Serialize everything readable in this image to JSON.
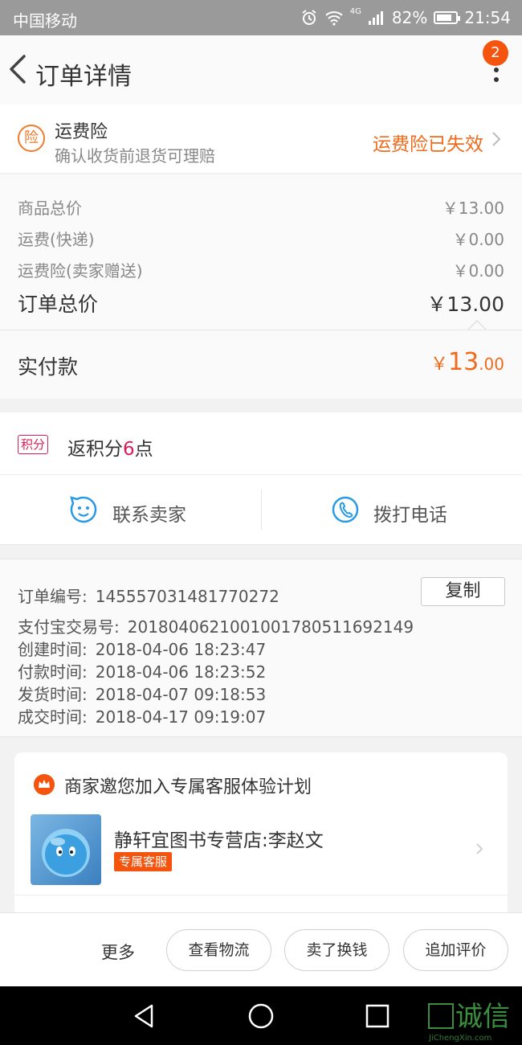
{
  "status_bar": {
    "carrier": "中国移动",
    "network": "4G",
    "battery": "82%",
    "battery_level": 0.82,
    "time": "21:54"
  },
  "nav": {
    "title": "订单详情",
    "badge": "2"
  },
  "insurance": {
    "icon_char": "险",
    "title": "运费险",
    "subtitle": "确认收货前退货可理赔",
    "status": "运费险已失效"
  },
  "prices": {
    "rows": [
      {
        "label": "商品总价",
        "value": "￥13.00"
      },
      {
        "label": "运费(快递)",
        "value": "￥0.00"
      },
      {
        "label": "运费险(卖家赠送)",
        "value": "￥0.00"
      }
    ],
    "total_label": "订单总价",
    "total_value": "￥13.00",
    "paid_label": "实付款",
    "paid_currency": "￥",
    "paid_int": "13",
    "paid_dec": ".00"
  },
  "points": {
    "tag": "积分",
    "prefix": "返积分",
    "num": "6",
    "suffix": "点"
  },
  "contact": {
    "seller": "联系卖家",
    "phone": "拨打电话"
  },
  "order_info": {
    "copy_label": "复制",
    "rows": [
      {
        "k": "订单编号:",
        "v": "1455570314817 70272"
      },
      {
        "k": "支付宝交易号:",
        "v": "2018040621001001780511692149"
      },
      {
        "k": "创建时间:",
        "v": "2018-04-06 18:23:47"
      },
      {
        "k": "付款时间:",
        "v": "2018-04-06 18:23:52"
      },
      {
        "k": "发货时间:",
        "v": "2018-04-07 09:18:53"
      },
      {
        "k": "成交时间:",
        "v": "2018-04-17 09:19:07"
      }
    ]
  },
  "service_card": {
    "title": "商家邀您加入专属客服体验计划",
    "shop": "静轩宜图书专营店:李赵文",
    "tag": "专属客服"
  },
  "actions": {
    "more": "更多",
    "logistics": "查看物流",
    "resell": "卖了换钱",
    "review": "追加评价"
  },
  "watermark": {
    "text": "诚信",
    "sub": "JiChengXin.com"
  },
  "colors": {
    "accent": "#ef6b1b",
    "badge": "#f5540f",
    "points": "#d81e57",
    "contact_icon": "#2a9be3"
  }
}
